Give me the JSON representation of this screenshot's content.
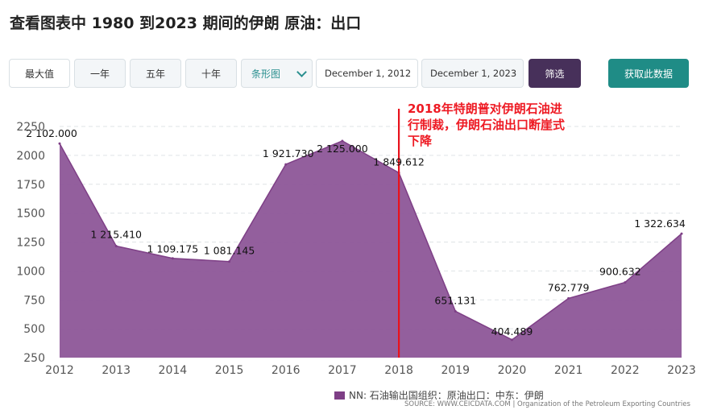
{
  "title": "查看图表中 1980 到2023 期间的伊朗 原油：出口",
  "toolbar": {
    "max_label": "最大值",
    "one_year_label": "一年",
    "five_year_label": "五年",
    "ten_year_label": "十年",
    "chart_type_label": "条形图",
    "start_date": "December 1, 2012",
    "end_date": "December 1, 2023",
    "filter_label": "筛选",
    "get_data_label": "获取此数据"
  },
  "annotation": "2018年特朗普对伊朗石油进行制裁，伊朗石油出口断崖式下降",
  "legend_label": "NN: 石油输出国组织：原油出口：中东：伊朗",
  "source_text": "SOURCE: WWW.CEICDATA.COM | Organization of the Petroleum Exporting Countries",
  "colors": {
    "area_fill": "#8f5a9a",
    "area_line": "#7e3f86",
    "marker_line": "#e8121c",
    "annotation": "#ee1b24",
    "filter_button": "#47305a",
    "get_data_button": "#1f8c86"
  },
  "chart_data": {
    "type": "area",
    "x": [
      "2012",
      "2013",
      "2014",
      "2015",
      "2016",
      "2017",
      "2018",
      "2019",
      "2020",
      "2021",
      "2022",
      "2023"
    ],
    "series": [
      {
        "name": "NN: 石油输出国组织：原油出口：中东：伊朗",
        "values": [
          2102.0,
          1215.41,
          1109.175,
          1081.145,
          1921.73,
          2125.0,
          1849.612,
          651.131,
          404.489,
          762.779,
          900.632,
          1322.634
        ],
        "labels": [
          "2 102.000",
          "1 215.410",
          "1 109.175",
          "1 081.145",
          "1 921.730",
          "2 125.000",
          "1 849.612",
          "651.131",
          "404.489",
          "762.779",
          "900.632",
          "1 322.634"
        ]
      }
    ],
    "ylim": [
      250,
      2250
    ],
    "yticks": [
      "250",
      "500",
      "750",
      "1000",
      "1250",
      "1500",
      "1750",
      "2000",
      "2250"
    ],
    "grid": true,
    "marker_x": "2018",
    "legend_position": "bottom"
  }
}
